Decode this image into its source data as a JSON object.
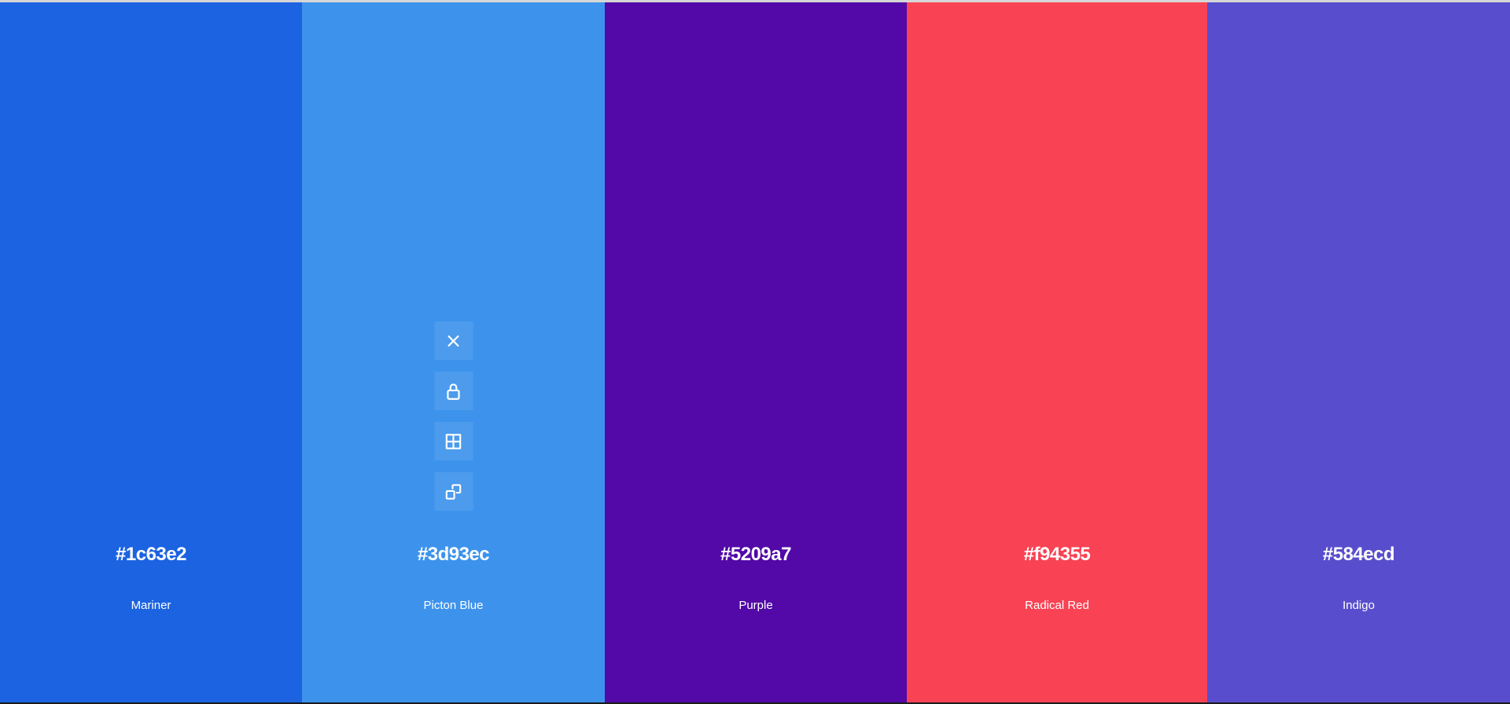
{
  "palette": {
    "colors": [
      {
        "hex": "#1c63e2",
        "name": "Mariner"
      },
      {
        "hex": "#3d93ec",
        "name": "Picton Blue"
      },
      {
        "hex": "#5209a7",
        "name": "Purple"
      },
      {
        "hex": "#f94355",
        "name": "Radical Red"
      },
      {
        "hex": "#584ecd",
        "name": "Indigo"
      }
    ],
    "hovered_index": 1,
    "tool_icons": [
      "close-icon",
      "lock-icon",
      "grid-icon",
      "copy-icon"
    ]
  }
}
